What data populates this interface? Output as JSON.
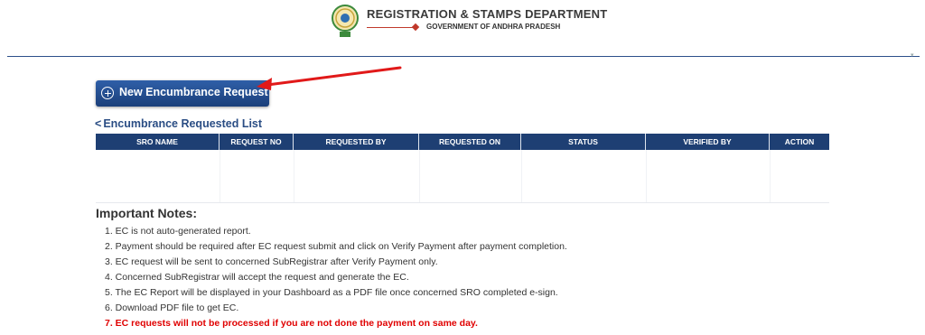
{
  "header": {
    "department": "REGISTRATION & STAMPS DEPARTMENT",
    "government": "GOVERNMENT OF ANDHRA PRADESH",
    "emblem_icon": "state-emblem-icon"
  },
  "actions": {
    "new_request_label": "New Encumbrance Request",
    "new_request_icon": "plus-circle-icon"
  },
  "list": {
    "title": "Encumbrance Requested List",
    "back_icon": "chevron-left-icon",
    "columns": [
      "SRO NAME",
      "REQUEST NO",
      "REQUESTED BY",
      "REQUESTED ON",
      "STATUS",
      "VERIFIED BY",
      "ACTION"
    ],
    "rows": []
  },
  "notes": {
    "title": "Important Notes:",
    "items": [
      "1. EC is not auto-generated report.",
      "2. Payment should be required after EC request submit and click on Verify Payment after payment completion.",
      "3. EC request will be sent to concerned SubRegistrar after Verify Payment only.",
      "4. Concerned SubRegistrar will accept the request and generate the EC.",
      "5. The EC Report will be displayed in your Dashboard as a PDF file once concerned SRO completed e-sign.",
      "6. Download PDF file to get EC.",
      "7. EC requests will not be processed if you are not done the payment on same day."
    ]
  },
  "colors": {
    "primary": "#1e3f73",
    "accent": "#2a4d84",
    "warning": "#e00000",
    "annotation_arrow": "#e11919"
  }
}
